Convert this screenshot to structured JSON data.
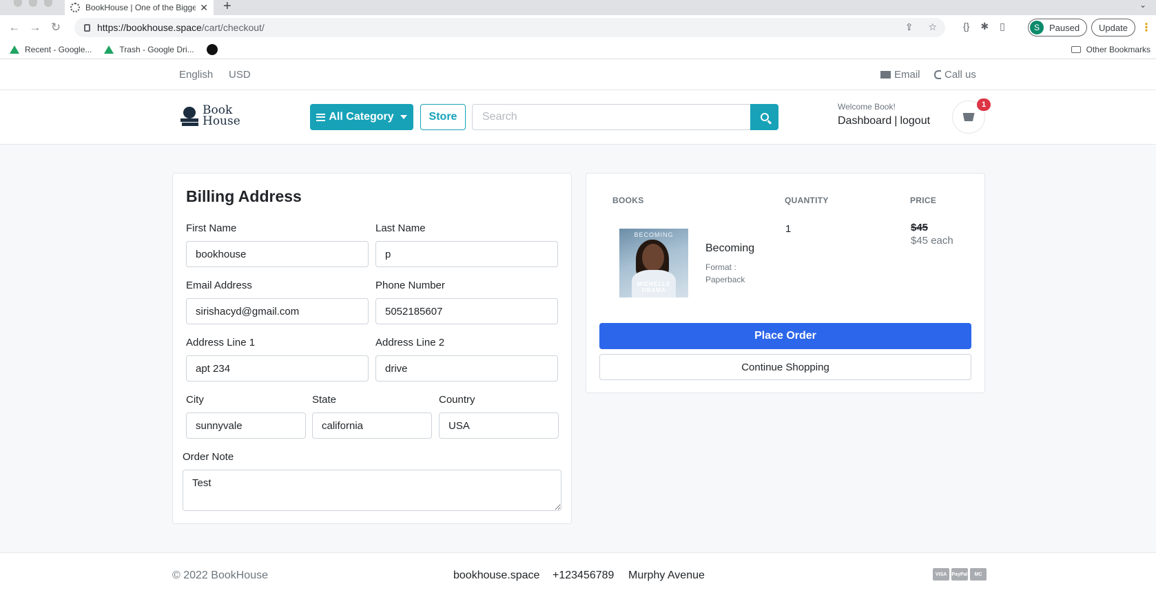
{
  "browser": {
    "tab_title": "BookHouse | One of the Bigges",
    "url_host": "https://bookhouse.space",
    "url_path": "/cart/checkout/",
    "profile_initial": "S",
    "profile_status": "Paused",
    "update_label": "Update",
    "bookmarks": [
      "Recent - Google...",
      "Trash - Google Dri..."
    ],
    "other_bookmarks": "Other Bookmarks"
  },
  "topbar": {
    "language": "English",
    "currency": "USD",
    "email": "Email",
    "call": "Call us"
  },
  "header": {
    "logo_line1": "Book",
    "logo_line2": "House",
    "category_button": "All Category",
    "store_button": "Store",
    "search_placeholder": "Search",
    "welcome": "Welcome Book!",
    "dashboard": "Dashboard",
    "separator": "|",
    "logout": "logout",
    "cart_count": "1"
  },
  "billing": {
    "title": "Billing Address",
    "first_name": {
      "label": "First Name",
      "value": "bookhouse"
    },
    "last_name": {
      "label": "Last Name",
      "value": "p"
    },
    "email": {
      "label": "Email Address",
      "value": "sirishacyd@gmail.com"
    },
    "phone": {
      "label": "Phone Number",
      "value": "5052185607"
    },
    "address1": {
      "label": "Address Line 1",
      "value": "apt 234"
    },
    "address2": {
      "label": "Address Line 2",
      "value": "drive"
    },
    "city": {
      "label": "City",
      "value": "sunnyvale"
    },
    "state": {
      "label": "State",
      "value": "california"
    },
    "country": {
      "label": "Country",
      "value": "USA"
    },
    "note": {
      "label": "Order Note",
      "value": "Test"
    }
  },
  "summary": {
    "col_books": "BOOKS",
    "col_quantity": "QUANTITY",
    "col_price": "PRICE",
    "item": {
      "cover_title": "BECOMING",
      "cover_author_1": "MICHELLE",
      "cover_author_2": "OBAMA",
      "name": "Becoming",
      "format_label": "Format :",
      "format_value": "Paperback",
      "quantity": "1",
      "price": "$45",
      "each": "$45 each"
    },
    "place_order": "Place Order",
    "continue_shopping": "Continue Shopping"
  },
  "footer": {
    "copyright": "© 2022 BookHouse",
    "site": "bookhouse.space",
    "phone": "+123456789",
    "address": "Murphy Avenue",
    "payments": [
      "VISA",
      "PayPal",
      "MC"
    ]
  }
}
